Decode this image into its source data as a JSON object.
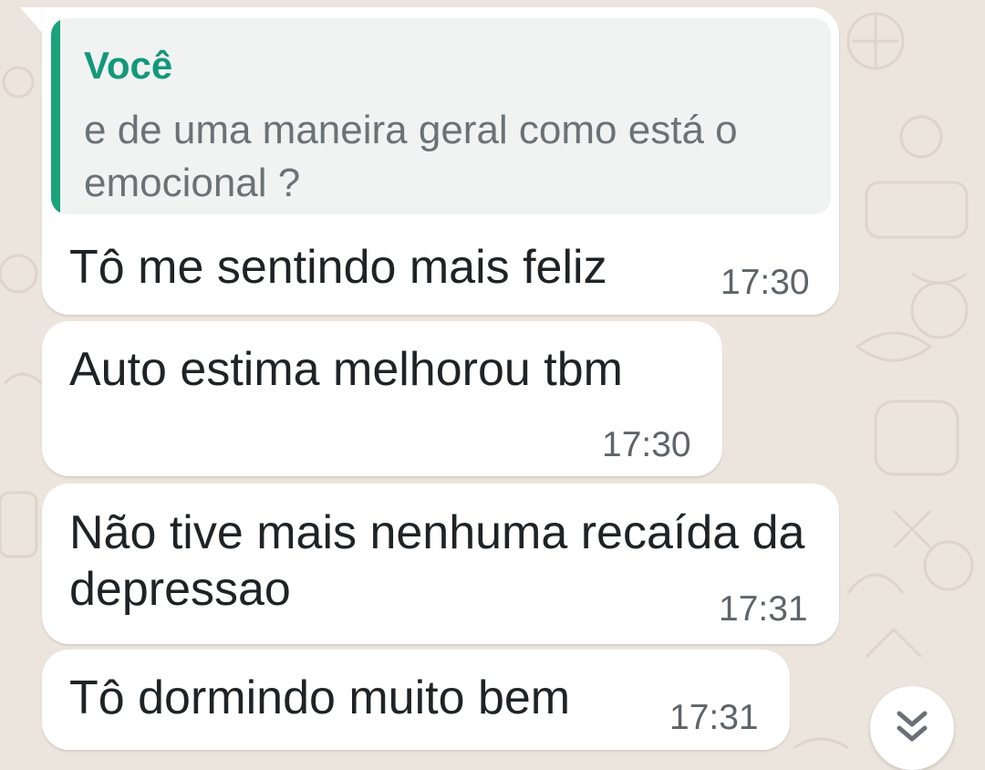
{
  "chat": {
    "messages": [
      {
        "quote_author": "Você",
        "quote_text": "e de uma maneira geral como está o emocional ?",
        "text": "Tô me sentindo mais feliz",
        "time": "17:30"
      },
      {
        "text": "Auto estima melhorou tbm",
        "time": "17:30"
      },
      {
        "text": "Não tive mais nenhuma recaída da depressao",
        "time": "17:31"
      },
      {
        "text": "Tô dormindo muito bem",
        "time": "17:31"
      }
    ]
  },
  "icons": {
    "scroll_down": "double-chevron-down-icon"
  },
  "colors": {
    "quote_accent": "#1aa27a",
    "quote_author": "#13987a",
    "chat_background": "#ece5dd",
    "bubble": "#ffffff"
  }
}
